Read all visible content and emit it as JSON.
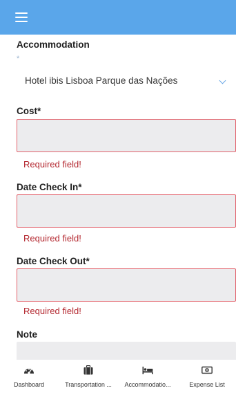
{
  "header": {
    "menu_icon": "hamburger-menu-icon"
  },
  "form": {
    "accommodation": {
      "label": "Accommodation",
      "required_mark": "*",
      "selected": "Hotel ibis Lisboa Parque das Nações"
    },
    "cost": {
      "label": "Cost*",
      "value": "",
      "error": "Required field!"
    },
    "check_in": {
      "label": "Date Check In*",
      "value": "",
      "error": "Required field!"
    },
    "check_out": {
      "label": "Date Check Out*",
      "value": "",
      "error": "Required field!"
    },
    "note": {
      "label": "Note",
      "value": ""
    }
  },
  "colors": {
    "appbar": "#5aa6ea",
    "error_text": "#b3262e",
    "error_border": "#e2606a",
    "input_bg": "#ececee"
  },
  "bottom_nav": [
    {
      "label": "Dashboard",
      "icon": "dashboard-gauge-icon"
    },
    {
      "label": "Transportation ...",
      "icon": "suitcase-icon"
    },
    {
      "label": "Accommodatio...",
      "icon": "bed-icon"
    },
    {
      "label": "Expense List",
      "icon": "money-bill-icon"
    }
  ]
}
